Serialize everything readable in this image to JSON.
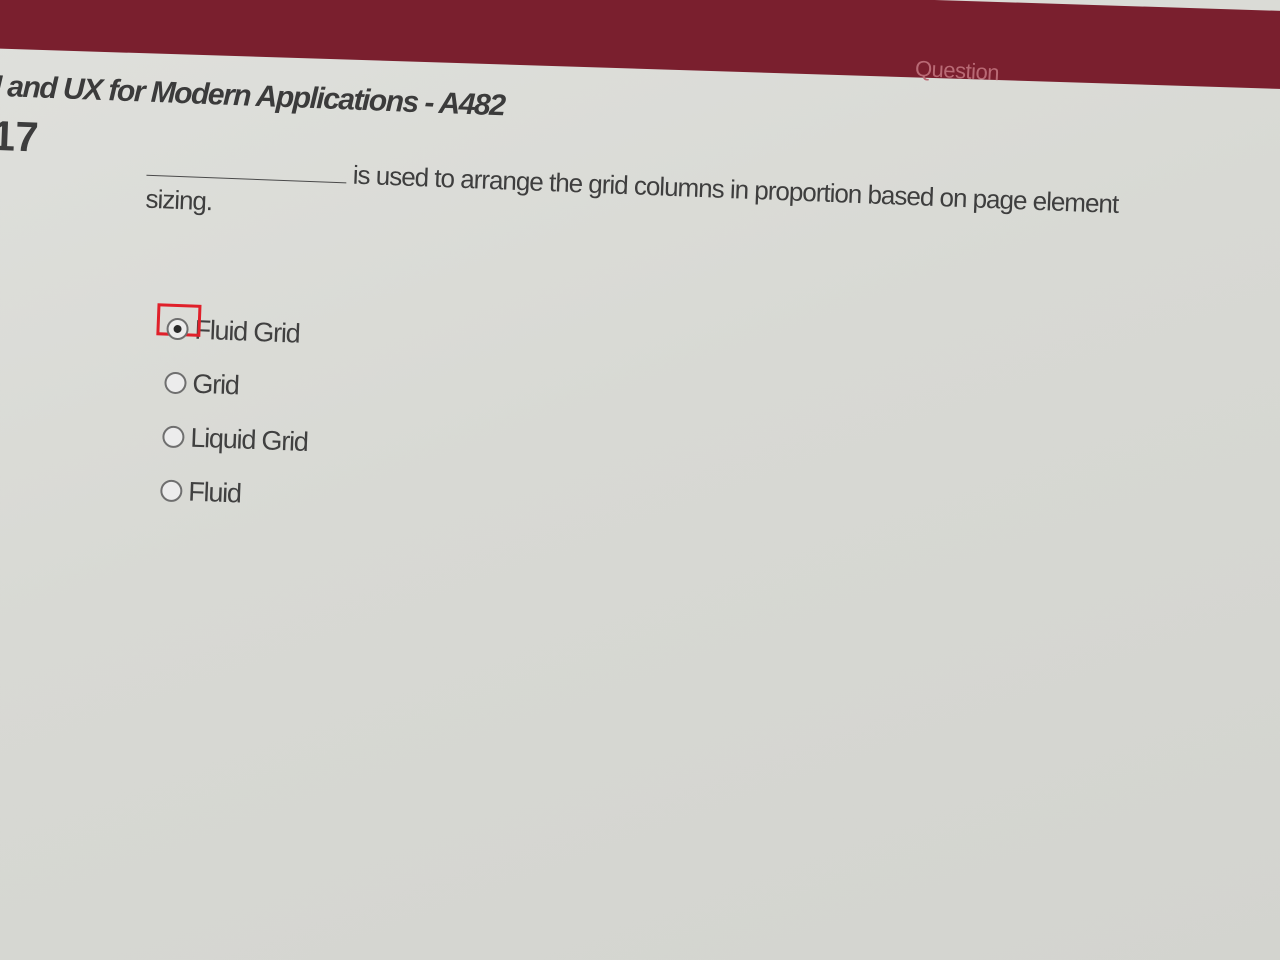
{
  "header": {
    "bar_label": "Question",
    "bar_color": "#7a1f2e"
  },
  "course": {
    "title": "I and UX for Modern Applications - A482",
    "question_number": "17"
  },
  "question": {
    "text": "is used to arrange the grid columns in proportion based on page element sizing."
  },
  "options": [
    {
      "label": "Fluid Grid",
      "selected": true
    },
    {
      "label": "Grid",
      "selected": false
    },
    {
      "label": "Liquid Grid",
      "selected": false
    },
    {
      "label": "Fluid",
      "selected": false
    }
  ],
  "highlight_color": "#e0202a"
}
